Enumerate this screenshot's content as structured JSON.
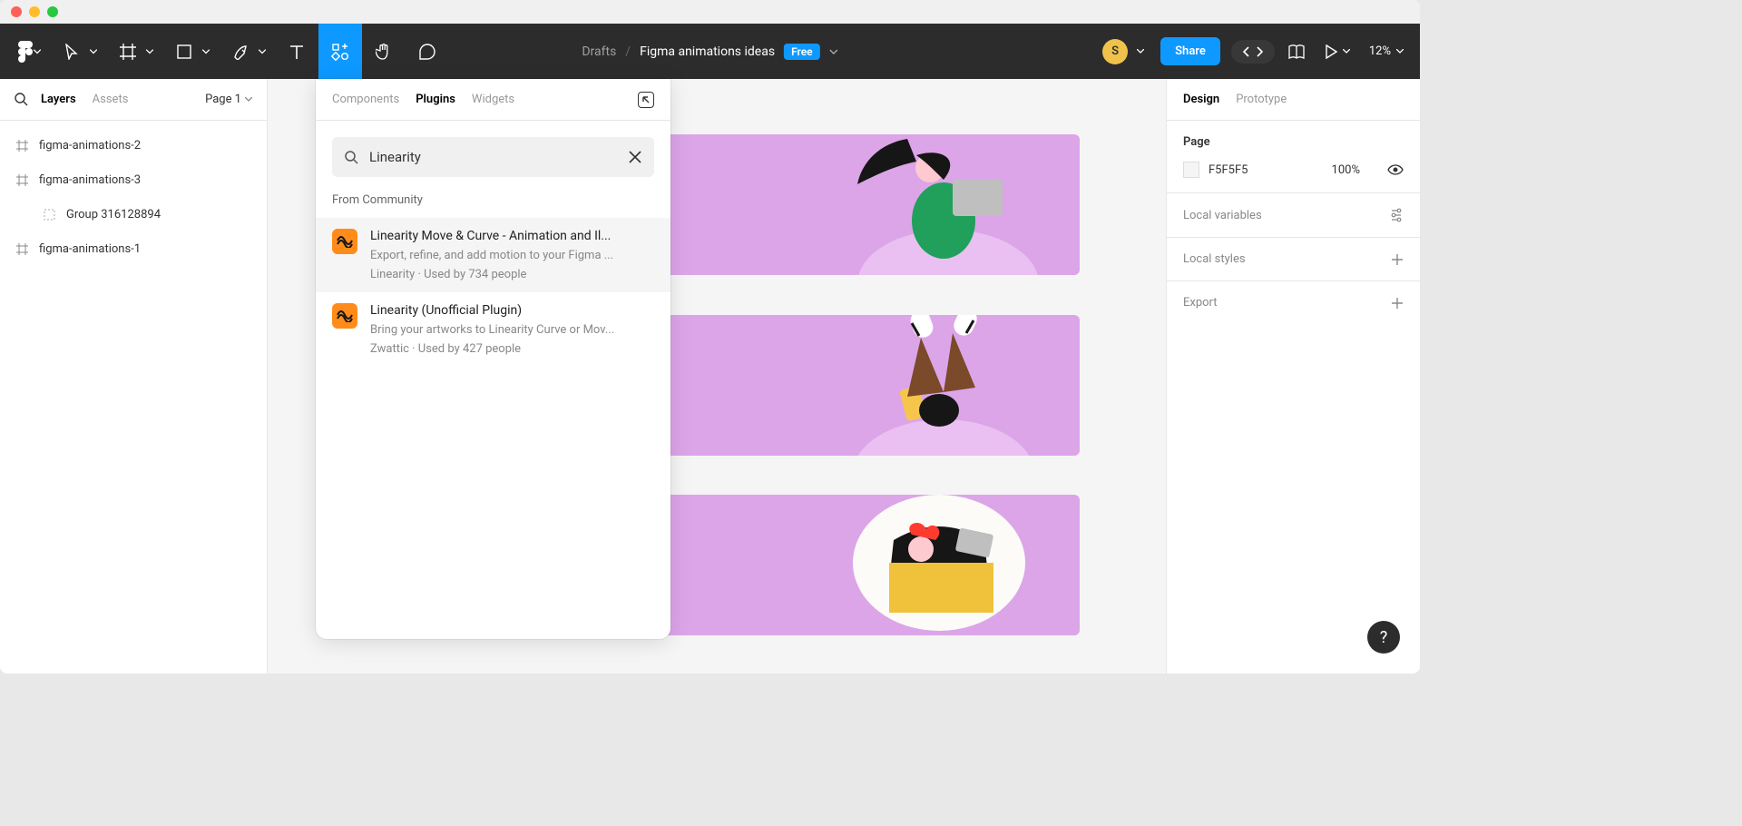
{
  "toolbar": {
    "drafts_label": "Drafts",
    "file_name": "Figma animations ideas",
    "free_badge": "Free",
    "avatar_letter": "S",
    "share_label": "Share",
    "zoom": "12%"
  },
  "left_panel": {
    "tabs": {
      "layers": "Layers",
      "assets": "Assets"
    },
    "page_selector": "Page 1",
    "layers": [
      {
        "name": "figma-animations-2",
        "type": "frame"
      },
      {
        "name": "figma-animations-3",
        "type": "frame"
      },
      {
        "name": "Group 316128894",
        "type": "group",
        "nested": true
      },
      {
        "name": "figma-animations-1",
        "type": "frame"
      }
    ]
  },
  "resources": {
    "tabs": {
      "components": "Components",
      "plugins": "Plugins",
      "widgets": "Widgets"
    },
    "search_value": "Linearity",
    "section_title": "From Community",
    "results": [
      {
        "title": "Linearity Move & Curve - Animation and Il...",
        "desc": "Export, refine, and add motion to your Figma ...",
        "meta": "Linearity · Used by 734 people",
        "selected": true
      },
      {
        "title": "Linearity (Unofficial Plugin)",
        "desc": "Bring your artworks to Linearity Curve or Mov...",
        "meta": "Zwattic · Used by 427 people",
        "selected": false
      }
    ]
  },
  "right_panel": {
    "tabs": {
      "design": "Design",
      "prototype": "Prototype"
    },
    "page_label": "Page",
    "color_hex": "F5F5F5",
    "opacity": "100%",
    "local_variables": "Local variables",
    "local_styles": "Local styles",
    "export": "Export"
  },
  "help_label": "?"
}
